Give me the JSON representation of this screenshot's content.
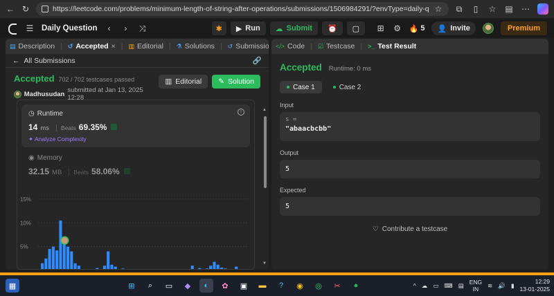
{
  "browser": {
    "url": "https://leetcode.com/problems/minimum-length-of-string-after-operations/submissions/1506984291/?envType=daily-question&envId=2025-01..."
  },
  "toolbar": {
    "problem_list_label": "Daily Question",
    "run_label": "Run",
    "submit_label": "Submit",
    "streak": "5",
    "invite_label": "Invite",
    "premium_label": "Premium"
  },
  "left_tabs": [
    {
      "label": "Description"
    },
    {
      "label": "Accepted",
      "close": "×"
    },
    {
      "label": "Editorial"
    },
    {
      "label": "Solutions"
    },
    {
      "label": "Submissions"
    }
  ],
  "submission": {
    "back_label": "All Submissions",
    "status": "Accepted",
    "testcases": "702 / 702 testcases passed",
    "user": "Madhusudan",
    "submitted_text": "submitted at Jan 13, 2025 12:28",
    "editorial_btn": "Editorial",
    "solution_btn": "Solution",
    "runtime": {
      "title": "Runtime",
      "value": "14",
      "unit": "ms",
      "beats_label": "Beats",
      "beats_pct": "69.35%",
      "analyze": "Analyze Complexity"
    },
    "memory": {
      "title": "Memory",
      "value": "32.15",
      "unit": "MB",
      "beats_label": "Beats",
      "beats_pct": "58.06%"
    }
  },
  "chart_data": {
    "type": "bar",
    "yticks": [
      "15%",
      "10%",
      "5%"
    ],
    "ylim": [
      0,
      16
    ],
    "values": [
      1.5,
      2.5,
      4.5,
      5,
      4.2,
      10.5,
      6,
      5,
      4,
      1.5,
      1,
      0,
      0,
      0,
      0,
      0.5,
      0,
      1,
      4,
      1.2,
      0.8,
      0,
      0.4,
      0,
      0,
      0.3,
      0,
      0,
      0.2,
      0,
      0,
      0.2,
      0,
      0,
      0.2,
      0,
      0,
      0,
      0,
      0,
      0,
      1,
      0,
      0.5,
      0.3,
      0.4,
      1,
      1.8,
      1.2,
      0.6,
      0.4,
      0.3,
      0.2,
      0.8,
      0.3,
      0.2
    ],
    "highlight_index": 6,
    "bar_color": "#2f8cff"
  },
  "right_tabs": [
    {
      "label": "Code"
    },
    {
      "label": "Testcase"
    },
    {
      "label": "Test Result"
    }
  ],
  "result": {
    "status": "Accepted",
    "runtime": "Runtime: 0 ms",
    "cases": [
      "Case 1",
      "Case 2"
    ],
    "input_label": "Input",
    "input_var": "s =",
    "input_value": "\"abaacbcbb\"",
    "output_label": "Output",
    "output_value": "5",
    "expected_label": "Expected",
    "expected_value": "5",
    "contribute": "Contribute a testcase"
  },
  "taskbar": {
    "lang1": "ENG",
    "lang2": "IN",
    "time": "12:29",
    "date": "13-01-2025"
  }
}
